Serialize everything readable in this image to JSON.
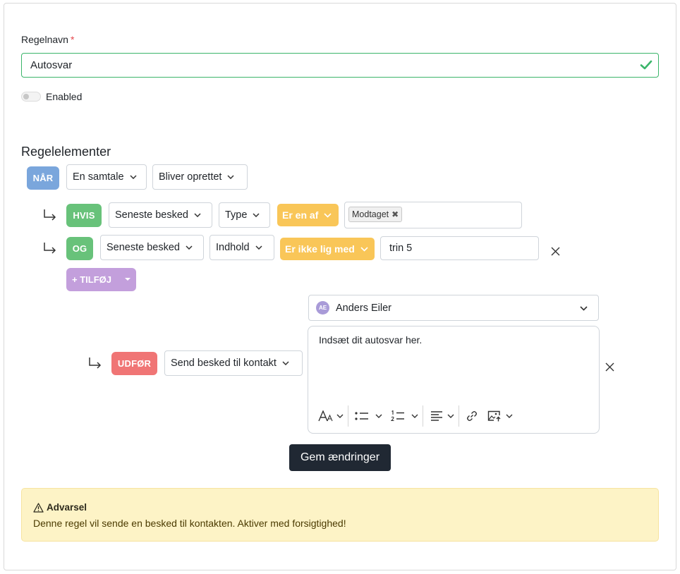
{
  "form": {
    "rule_name_label": "Regelnavn",
    "required_mark": "*",
    "rule_name_value": "Autosvar",
    "enabled_label": "Enabled"
  },
  "rules": {
    "section_title": "Regelelementer",
    "when": {
      "badge": "NÅR",
      "subject": "En samtale",
      "event": "Bliver oprettet"
    },
    "if_row": {
      "badge": "HVIS",
      "field": "Seneste besked",
      "attribute": "Type",
      "operator": "Er en af",
      "tags": [
        "Modtaget"
      ],
      "tag_remove": "✖"
    },
    "and_row": {
      "badge": "OG",
      "field": "Seneste besked",
      "attribute": "Indhold",
      "operator": "Er ikke lig med",
      "value": "trin 5"
    },
    "add_button": "+ TILFØJ",
    "action": {
      "badge": "UDFØR",
      "type": "Send besked til kontakt",
      "agent_initials": "AE",
      "agent_name": "Anders Eiler",
      "message_text": "Indsæt dit autosvar her."
    }
  },
  "save_button": "Gem ændringer",
  "warning": {
    "icon": "⚠",
    "title": "Advarsel",
    "message": "Denne regel vil sende en besked til kontakten. Aktiver med forsigtighed!"
  },
  "colors": {
    "when_badge": "#7aa6dc",
    "if_badge": "#68c27a",
    "action_badge": "#f07575",
    "operator": "#f9c658",
    "add_button": "#c39fdc",
    "save_button": "#202833",
    "valid_border": "#3bb56a",
    "warning_bg": "#fdf3c6"
  },
  "icons": {
    "valid": "check-icon",
    "close": "close-icon",
    "nested": "return-arrow-icon",
    "dropdown": "chevron-down-icon"
  }
}
